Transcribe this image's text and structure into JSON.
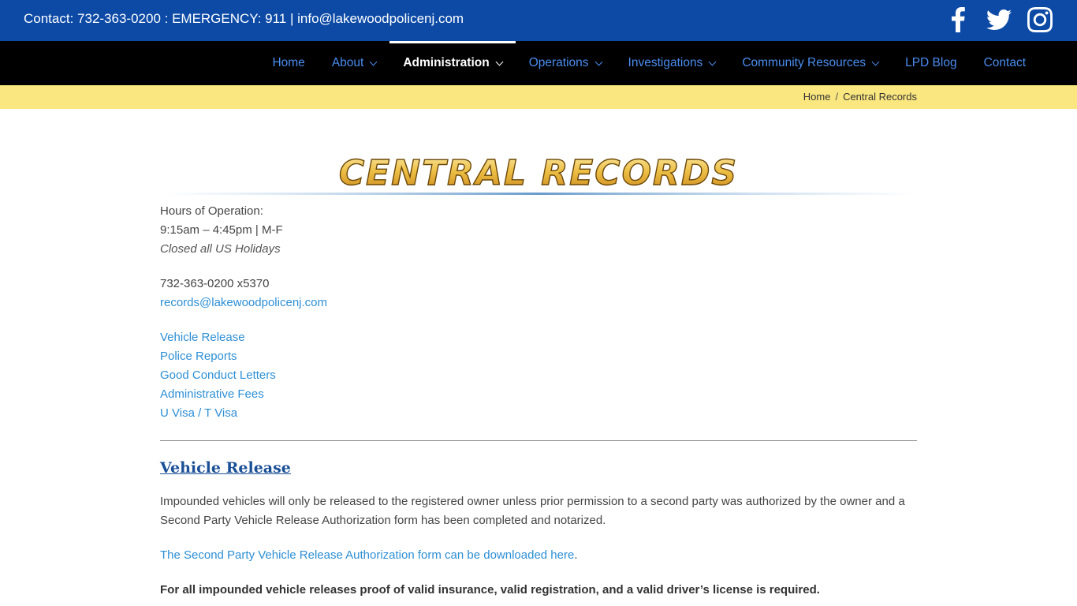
{
  "topbar": {
    "contact_text": "Contact: 732-363-0200 : EMERGENCY: 911 | info@lakewoodpolicenj.com",
    "social_icons": [
      "facebook-icon",
      "twitter-icon",
      "instagram-icon"
    ]
  },
  "nav": {
    "items": [
      {
        "label": "Home"
      },
      {
        "label": "About"
      },
      {
        "label": "Administration"
      },
      {
        "label": "Operations"
      },
      {
        "label": "Investigations"
      },
      {
        "label": "Community Resources"
      },
      {
        "label": "LPD Blog"
      },
      {
        "label": "Contact"
      }
    ],
    "active_label": "Administration"
  },
  "breadcrumb": {
    "home": "Home",
    "separator": "/",
    "current": "Central Records"
  },
  "banner": {
    "title": "CENTRAL RECORDS"
  },
  "hours": {
    "label": "Hours of Operation:",
    "times": "9:15am – 4:45pm | M-F",
    "holidays": "Closed all US Holidays"
  },
  "contact": {
    "phone": "732-363-0200 x5370",
    "email": "records@lakewoodpolicenj.com"
  },
  "quick_links": [
    "Vehicle Release",
    "Police Reports",
    "Good Conduct Letters",
    "Administrative Fees",
    "U Visa / T Visa"
  ],
  "vehicle_release": {
    "title": "Vehicle Release",
    "paragraph1": "Impounded vehicles will only be released to the registered owner unless prior permission to a second party was authorized by the owner and a Second Party Vehicle Release Authorization form has been completed and notarized.",
    "download_link": "The Second Party Vehicle Release Authorization form can be downloaded here",
    "download_suffix": ".",
    "requirement": "For all impounded vehicle releases proof of valid insurance, valid registration, and a valid driver’s license is required."
  },
  "colors": {
    "topbar_bg": "#0c4aa6",
    "nav_bg": "#000000",
    "nav_link": "#4a8df0",
    "breadcrumb_bg": "#fbe77f",
    "link": "#2d8fd5",
    "section_title": "#1a4f96",
    "banner_gold": "#e8b73a"
  }
}
